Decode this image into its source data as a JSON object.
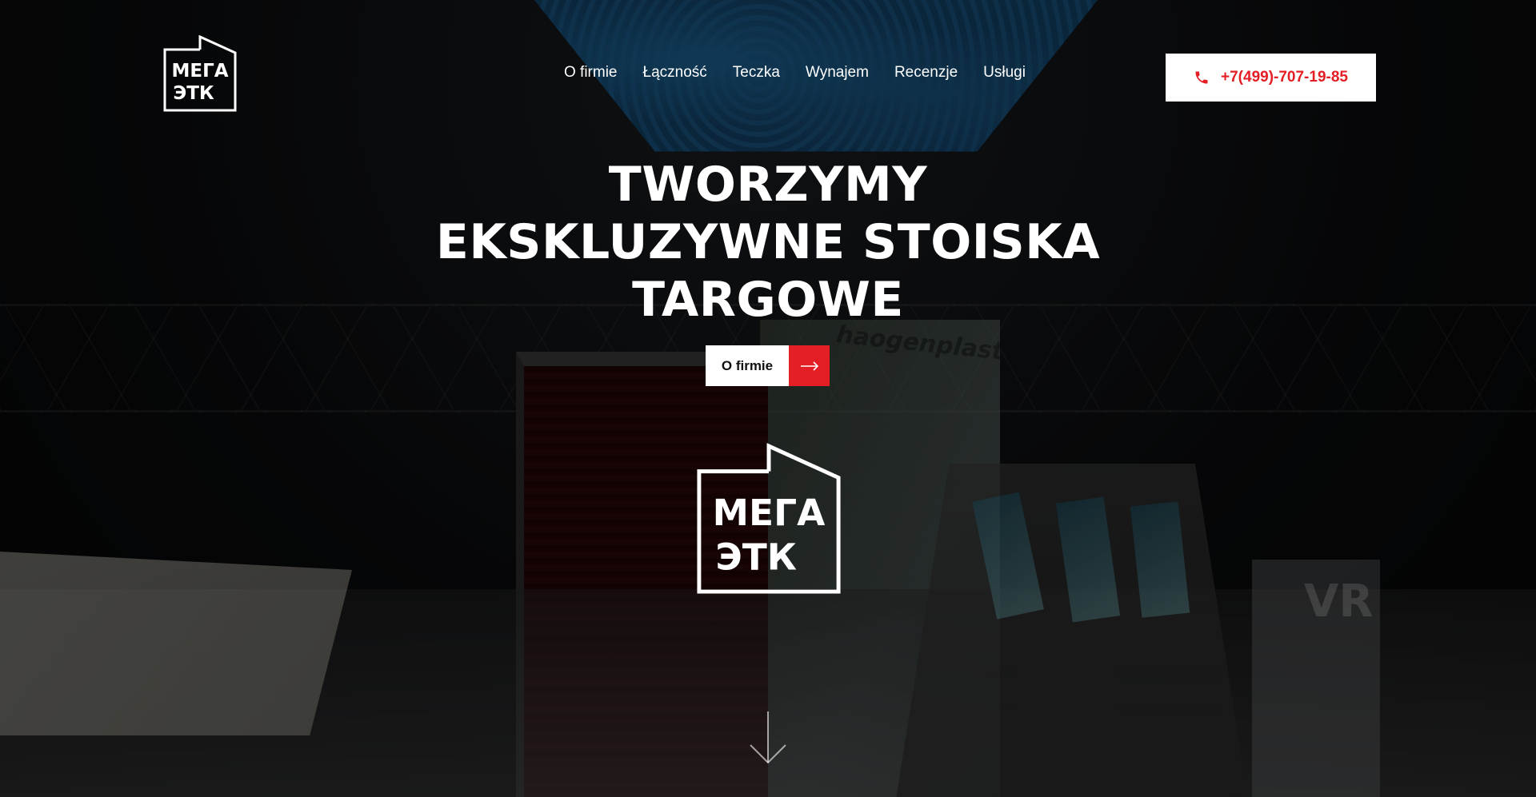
{
  "header": {
    "logo": {
      "line1": "МЕГА",
      "line2": "ЭТК"
    },
    "nav": [
      {
        "label": "O firmie"
      },
      {
        "label": "Łączność"
      },
      {
        "label": "Teczka"
      },
      {
        "label": "Wynajem"
      },
      {
        "label": "Recenzje"
      },
      {
        "label": "Usługi"
      }
    ],
    "phone": {
      "number": "+7(499)-707-19-85",
      "icon": "phone-icon"
    }
  },
  "hero": {
    "title_lines": [
      "TWORZYMY",
      "EKSKLUZYWNE STOISKA",
      "TARGOWE"
    ],
    "cta_label": "O firmie",
    "cta_icon": "arrow-right-icon",
    "center_logo": {
      "line1": "МЕГА",
      "line2": "ЭТК"
    },
    "background_sign_text": "haogenplast",
    "background_vr_text": "VR",
    "scroll_icon": "arrow-down-icon"
  },
  "colors": {
    "accent": "#e31e24",
    "text_light": "#ffffff",
    "background": "#050608"
  }
}
